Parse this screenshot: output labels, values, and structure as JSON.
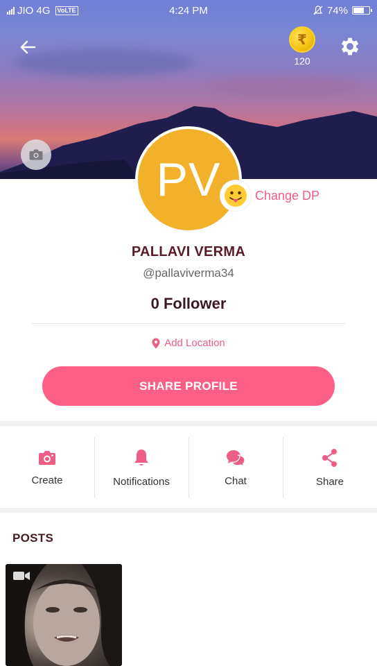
{
  "status_bar": {
    "carrier": "JIO 4G",
    "volte": "VoLTE",
    "time": "4:24 PM",
    "battery": "74%",
    "battery_level": 0.74
  },
  "header": {
    "coin_symbol": "₹",
    "coin_count": "120"
  },
  "profile": {
    "initials": "PV",
    "change_dp_label": "Change DP",
    "name": "PALLAVI VERMA",
    "handle": "@pallaviverma34",
    "followers": "0 Follower",
    "add_location": "Add Location",
    "share_button": "SHARE PROFILE",
    "avatar_color": "#f2b12b"
  },
  "actions": [
    {
      "label": "Create",
      "icon": "camera-icon"
    },
    {
      "label": "Notifications",
      "icon": "bell-icon"
    },
    {
      "label": "Chat",
      "icon": "chat-icon"
    },
    {
      "label": "Share",
      "icon": "share-icon"
    }
  ],
  "posts": {
    "title": "POSTS"
  },
  "colors": {
    "accent": "#fb5f86",
    "accent_text": "#ee5d83",
    "name_color": "#5a1a28"
  }
}
